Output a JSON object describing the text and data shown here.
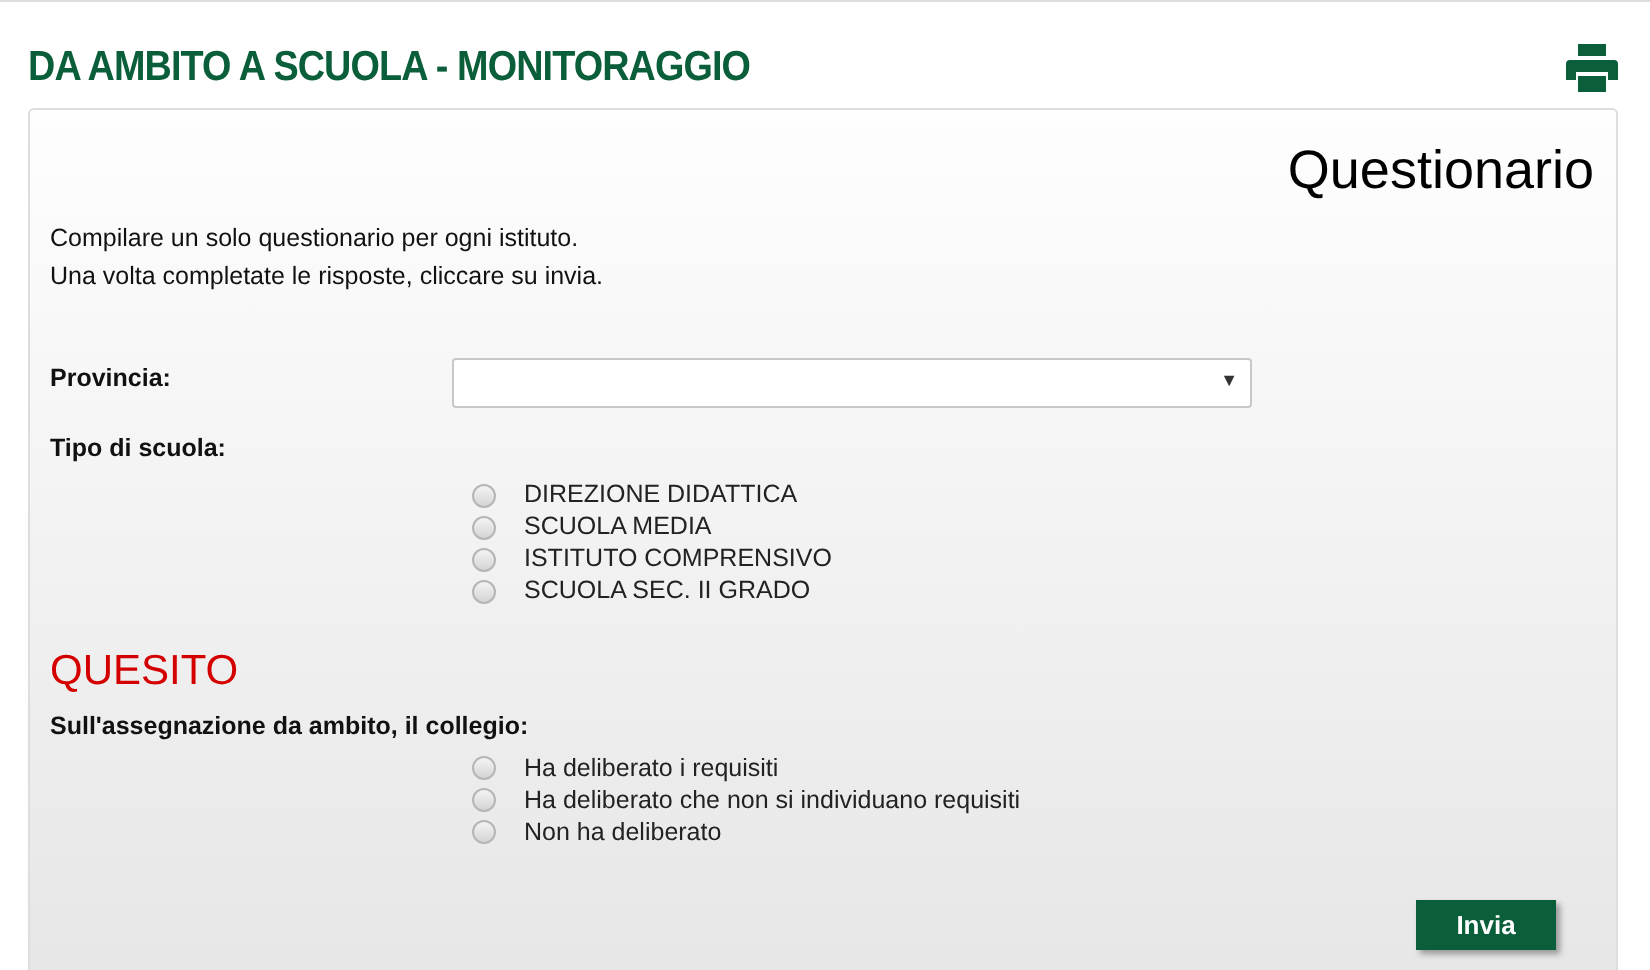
{
  "header": {
    "title": "DA AMBITO A SCUOLA - MONITORAGGIO"
  },
  "card": {
    "title": "Questionario",
    "intro": [
      "Compilare un solo questionario per ogni istituto.",
      "Una volta completate le risposte, cliccare su invia."
    ]
  },
  "provincia": {
    "label": "Provincia:",
    "caret": "▼"
  },
  "tipo_scuola": {
    "label": "Tipo di scuola:",
    "options": [
      {
        "label": "DIREZIONE DIDATTICA",
        "selected": false
      },
      {
        "label": "SCUOLA MEDIA",
        "selected": false
      },
      {
        "label": "ISTITUTO COMPRENSIVO",
        "selected": false
      },
      {
        "label": "SCUOLA SEC. II GRADO",
        "selected": false
      }
    ]
  },
  "quesito": {
    "heading": "QUESITO",
    "question": "Sull'assegnazione da ambito, il collegio:",
    "options": [
      {
        "label": "Ha deliberato i requisiti",
        "selected": false
      },
      {
        "label": "Ha deliberato che non si individuano requisiti",
        "selected": false
      },
      {
        "label": "Non ha deliberato",
        "selected": false
      }
    ]
  },
  "submit": "Invia"
}
